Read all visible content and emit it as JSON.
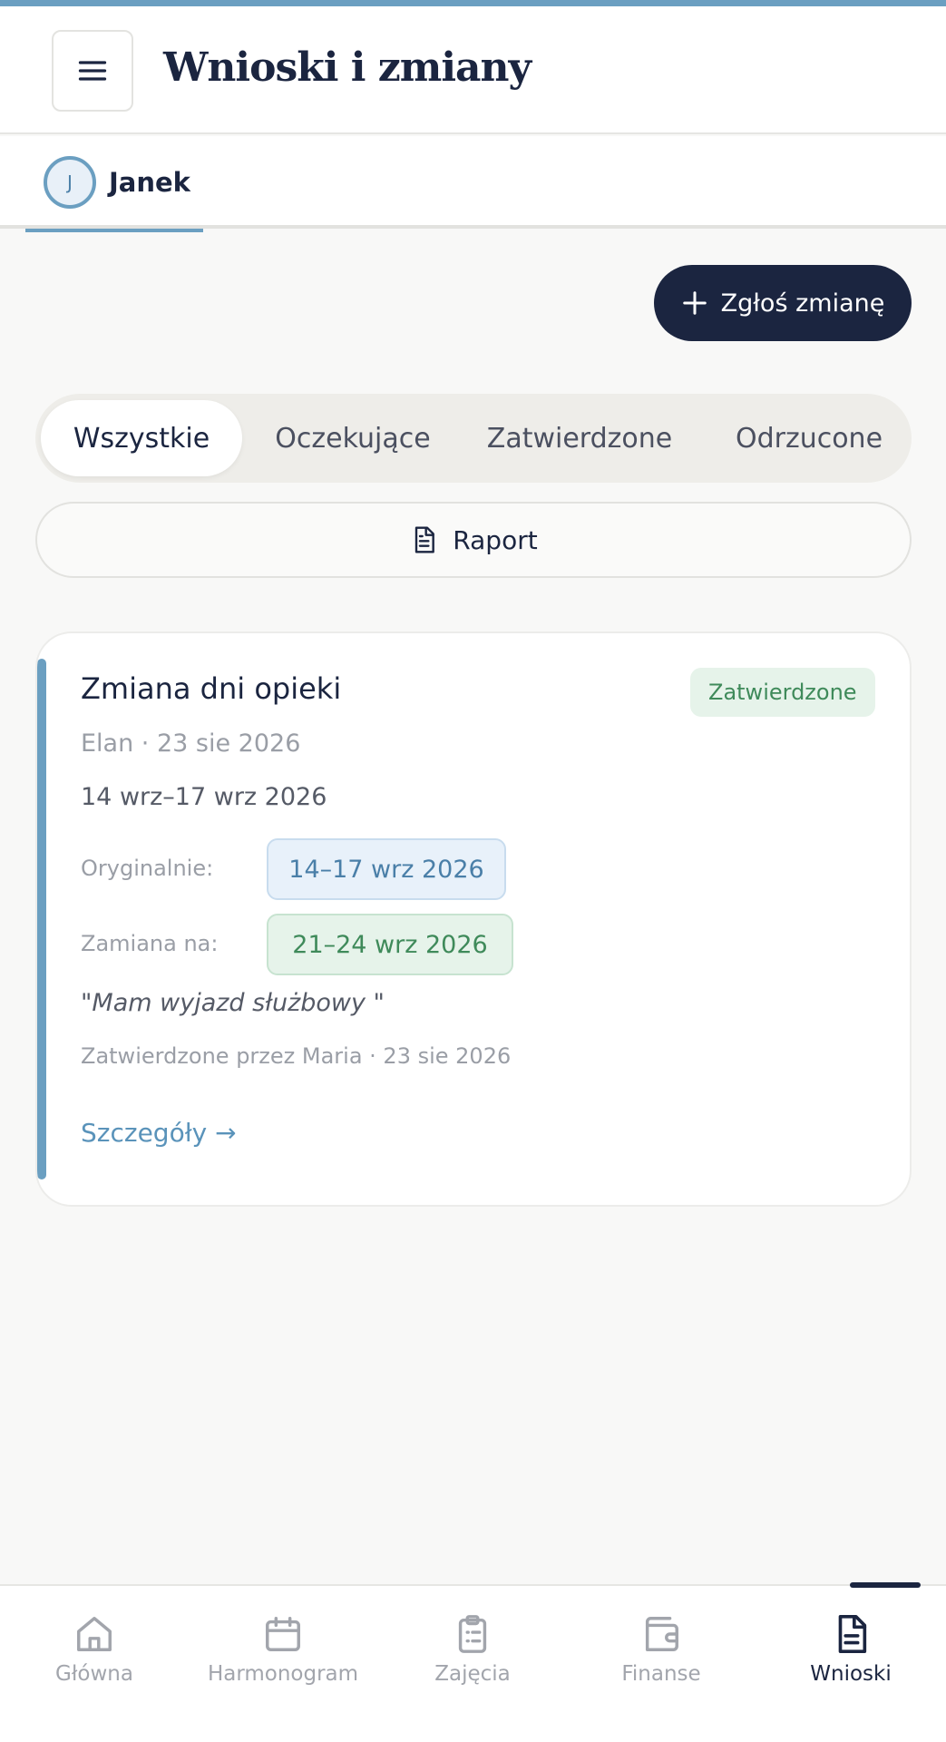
{
  "header": {
    "title": "Wnioski i zmiany"
  },
  "children": [
    {
      "initial": "J",
      "name": "Janek",
      "active": true
    }
  ],
  "actions": {
    "add_label": "Zgłoś zmianę",
    "report_label": "Raport"
  },
  "filters": [
    {
      "label": "Wszystkie",
      "active": true
    },
    {
      "label": "Oczekujące",
      "active": false
    },
    {
      "label": "Zatwierdzone",
      "active": false
    },
    {
      "label": "Odrzucone",
      "active": false
    }
  ],
  "requests": [
    {
      "title": "Zmiana dni opieki",
      "status": "Zatwierdzone",
      "meta": "Elan · 23 sie 2026",
      "range": "14 wrz–17 wrz 2026",
      "original_label": "Oryginalnie:",
      "original_value": "14–17 wrz 2026",
      "swap_label": "Zamiana na:",
      "swap_value": "21–24 wrz 2026",
      "note": "\"Mam wyjazd służbowy \"",
      "approval": "Zatwierdzone przez Maria · 23 sie 2026",
      "details_label": "Szczegóły →"
    }
  ],
  "nav": [
    {
      "label": "Główna",
      "icon": "home-icon",
      "active": false
    },
    {
      "label": "Harmonogram",
      "icon": "calendar-icon",
      "active": false
    },
    {
      "label": "Zajęcia",
      "icon": "clipboard-icon",
      "active": false
    },
    {
      "label": "Finanse",
      "icon": "wallet-icon",
      "active": false
    },
    {
      "label": "Wnioski",
      "icon": "document-icon",
      "active": true
    }
  ],
  "colors": {
    "accent": "#6b9fc1",
    "primary_dark": "#1b2540",
    "approved_green": "#3f8a5a",
    "background": "#f8f8f7"
  }
}
